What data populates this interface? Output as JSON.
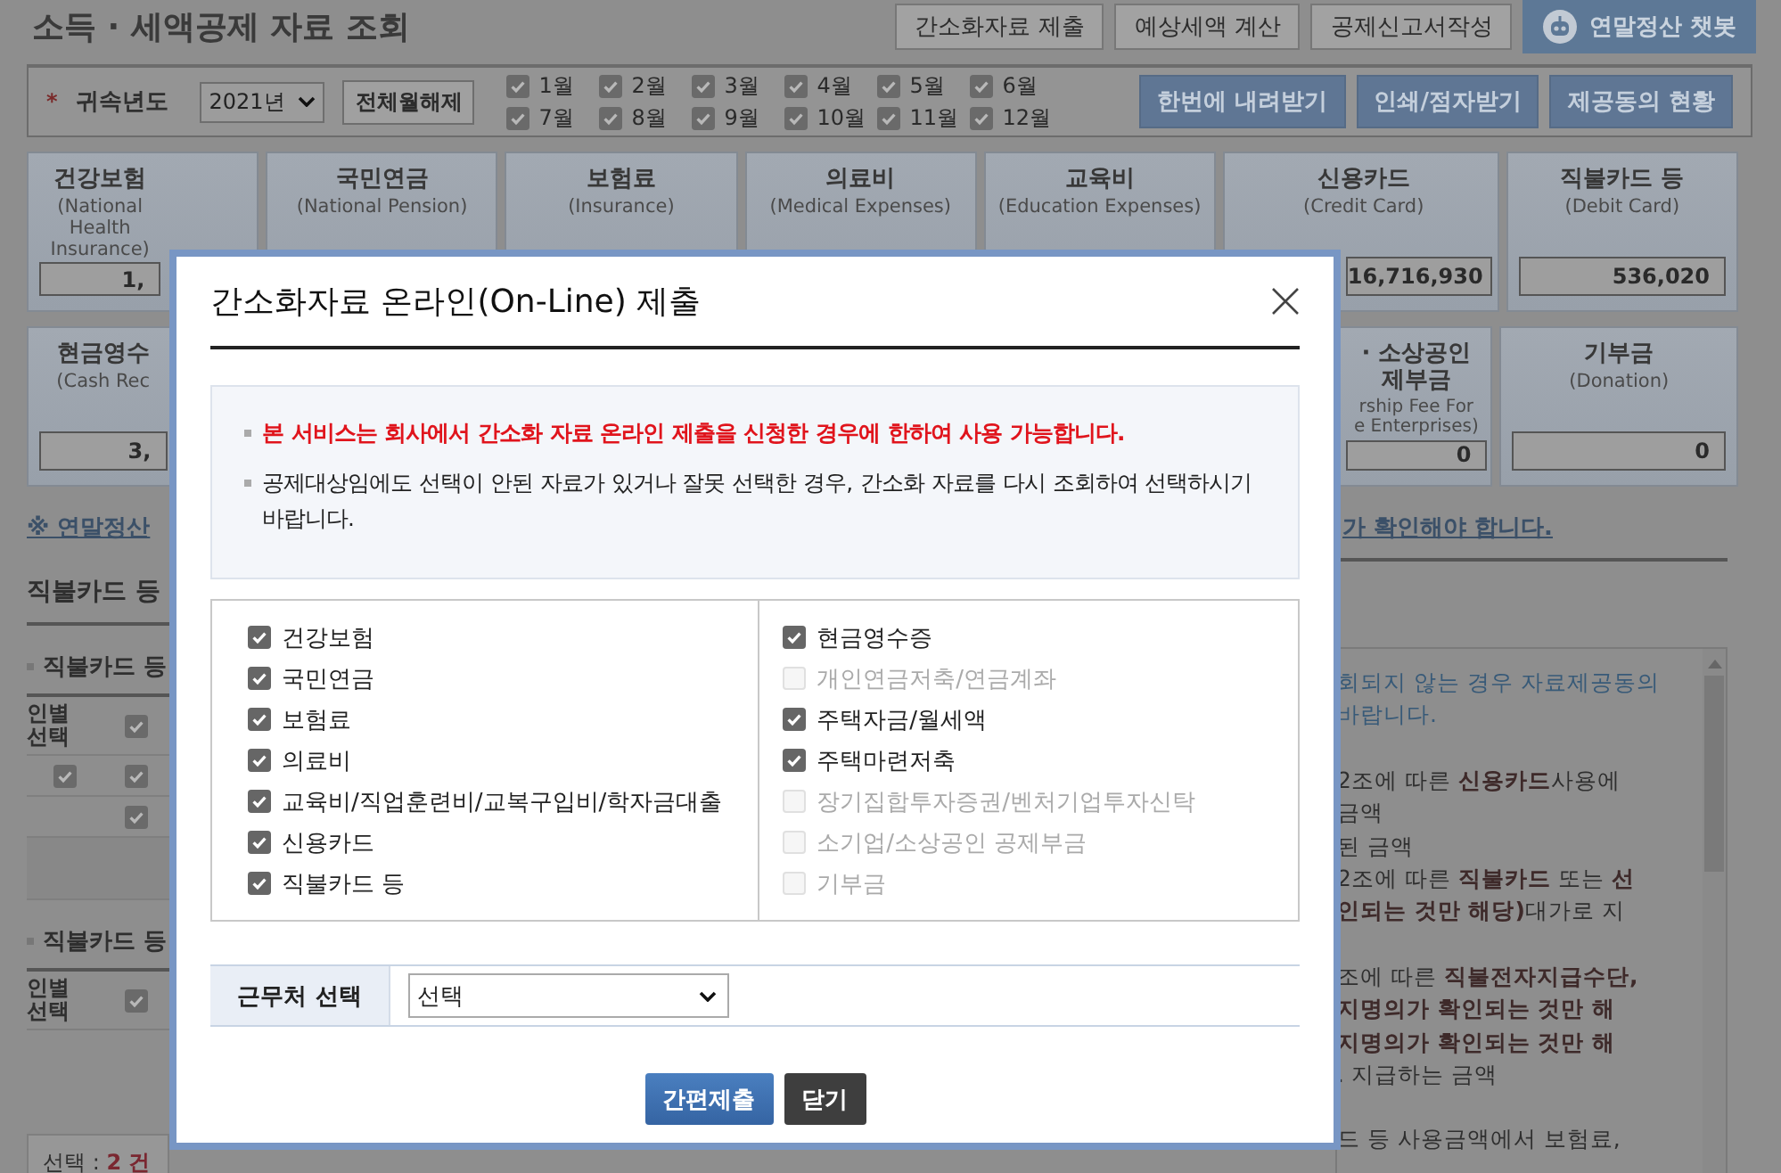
{
  "page": {
    "title": "소득 · 세액공제 자료 조회",
    "top_buttons": [
      {
        "label": "간소화자료 제출",
        "kind": "plain"
      },
      {
        "label": "예상세액 계산",
        "kind": "plain"
      },
      {
        "label": "공제신고서작성",
        "kind": "plain"
      },
      {
        "label": "연말정산 챗봇",
        "kind": "chatbot"
      }
    ]
  },
  "filter": {
    "required_mark": "*",
    "year_label": "귀속년도",
    "year": "2021년",
    "clear_button": "전체월해제",
    "months": [
      {
        "label": "1월",
        "checked": true
      },
      {
        "label": "2월",
        "checked": true
      },
      {
        "label": "3월",
        "checked": true
      },
      {
        "label": "4월",
        "checked": true
      },
      {
        "label": "5월",
        "checked": true
      },
      {
        "label": "6월",
        "checked": true
      },
      {
        "label": "7월",
        "checked": true
      },
      {
        "label": "8월",
        "checked": true
      },
      {
        "label": "9월",
        "checked": true
      },
      {
        "label": "10월",
        "checked": true
      },
      {
        "label": "11월",
        "checked": true
      },
      {
        "label": "12월",
        "checked": true
      }
    ],
    "actions": [
      "한번에 내려받기",
      "인쇄/점자받기",
      "제공동의 현황"
    ]
  },
  "cards_row1": [
    {
      "title": "건강보험",
      "subtitle": "(National Health Insurance)",
      "value": "1,"
    },
    {
      "title": "국민연금",
      "subtitle": "(National Pension)"
    },
    {
      "title": "보험료",
      "subtitle": "(Insurance)"
    },
    {
      "title": "의료비",
      "subtitle": "(Medical Expenses)"
    },
    {
      "title": "교육비",
      "subtitle": "(Education Expenses)"
    },
    {
      "title": "신용카드",
      "subtitle": "(Credit Card)",
      "value": "16,716,930"
    },
    {
      "title": "직불카드 등",
      "subtitle": "(Debit Card)",
      "value": "536,020"
    }
  ],
  "cards_row2": [
    {
      "title": "현금영수",
      "subtitle": "(Cash Rec",
      "value": "3,"
    },
    {
      "title": "· 소상공인\n제부금",
      "subtitle": "rship Fee For\ne Enterprises)",
      "value": "0"
    },
    {
      "title": "기부금",
      "subtitle": "(Donation)",
      "value": "0"
    }
  ],
  "notice_link_left": "※ 연말정산",
  "notice_link_right": "가 확인해야 합니다.",
  "left_section": {
    "heading": "직불카드 등",
    "groups": [
      {
        "title": "직불카드 등",
        "header": {
          "label": "인별\n선택",
          "checked": true
        },
        "rows": [
          {
            "person_checked": true,
            "item_checked": true
          },
          {
            "item_checked": true
          }
        ]
      },
      {
        "title": "직불카드 등",
        "header": {
          "label": "인별\n선택",
          "checked": true
        }
      }
    ],
    "summary": {
      "label": "선택 :",
      "count": "2 건"
    }
  },
  "right_panel": {
    "paragraphs": [
      {
        "kind": "notice",
        "lines": [
          "회되지 않는 경우 자료제공동의",
          "바랍니다."
        ]
      },
      {
        "kind": "body",
        "lines": [
          "2조에 따른 **신용카드**사용에",
          "금액",
          "된 금액",
          "2조에 따른 **직불카드** 또는 **선**",
          "**인되는 것만 해당)**대가로 지"
        ]
      },
      {
        "kind": "body",
        "lines": [
          "조에 따른 **직불전자지급수단,**",
          "**지명의가 확인되는 것만 해**",
          "**지명의가 확인되는 것만 해**",
          ". 지급하는 금액"
        ]
      },
      {
        "kind": "body",
        "lines": [
          "드 등 사용금액에서 보험료,"
        ]
      }
    ]
  },
  "modal": {
    "title": "간소화자료 온라인(On-Line) 제출",
    "notices": [
      {
        "kind": "warning",
        "text": "본 서비스는 회사에서 간소화 자료 온라인 제출을 신청한 경우에 한하여 사용 가능합니다."
      },
      {
        "kind": "info",
        "text": "공제대상임에도 선택이 안된 자료가 있거나 잘못 선택한 경우, 간소화 자료를 다시 조회하여 선택하시기 바랍니다."
      }
    ],
    "columns": [
      [
        {
          "label": "건강보험",
          "checked": true,
          "disabled": false
        },
        {
          "label": "국민연금",
          "checked": true,
          "disabled": false
        },
        {
          "label": "보험료",
          "checked": true,
          "disabled": false
        },
        {
          "label": "의료비",
          "checked": true,
          "disabled": false
        },
        {
          "label": "교육비/직업훈련비/교복구입비/학자금대출",
          "checked": true,
          "disabled": false
        },
        {
          "label": "신용카드",
          "checked": true,
          "disabled": false
        },
        {
          "label": "직불카드 등",
          "checked": true,
          "disabled": false
        }
      ],
      [
        {
          "label": "현금영수증",
          "checked": true,
          "disabled": false
        },
        {
          "label": "개인연금저축/연금계좌",
          "checked": false,
          "disabled": true
        },
        {
          "label": "주택자금/월세액",
          "checked": true,
          "disabled": false
        },
        {
          "label": "주택마련저축",
          "checked": true,
          "disabled": false
        },
        {
          "label": "장기집합투자증권/벤처기업투자신탁",
          "checked": false,
          "disabled": true
        },
        {
          "label": "소기업/소상공인 공제부금",
          "checked": false,
          "disabled": true
        },
        {
          "label": "기부금",
          "checked": false,
          "disabled": true
        }
      ]
    ],
    "workplace_label": "근무처 선택",
    "workplace_value": "선택",
    "buttons": [
      {
        "label": "간편제출",
        "kind": "primary"
      },
      {
        "label": "닫기",
        "kind": "dark"
      }
    ]
  }
}
